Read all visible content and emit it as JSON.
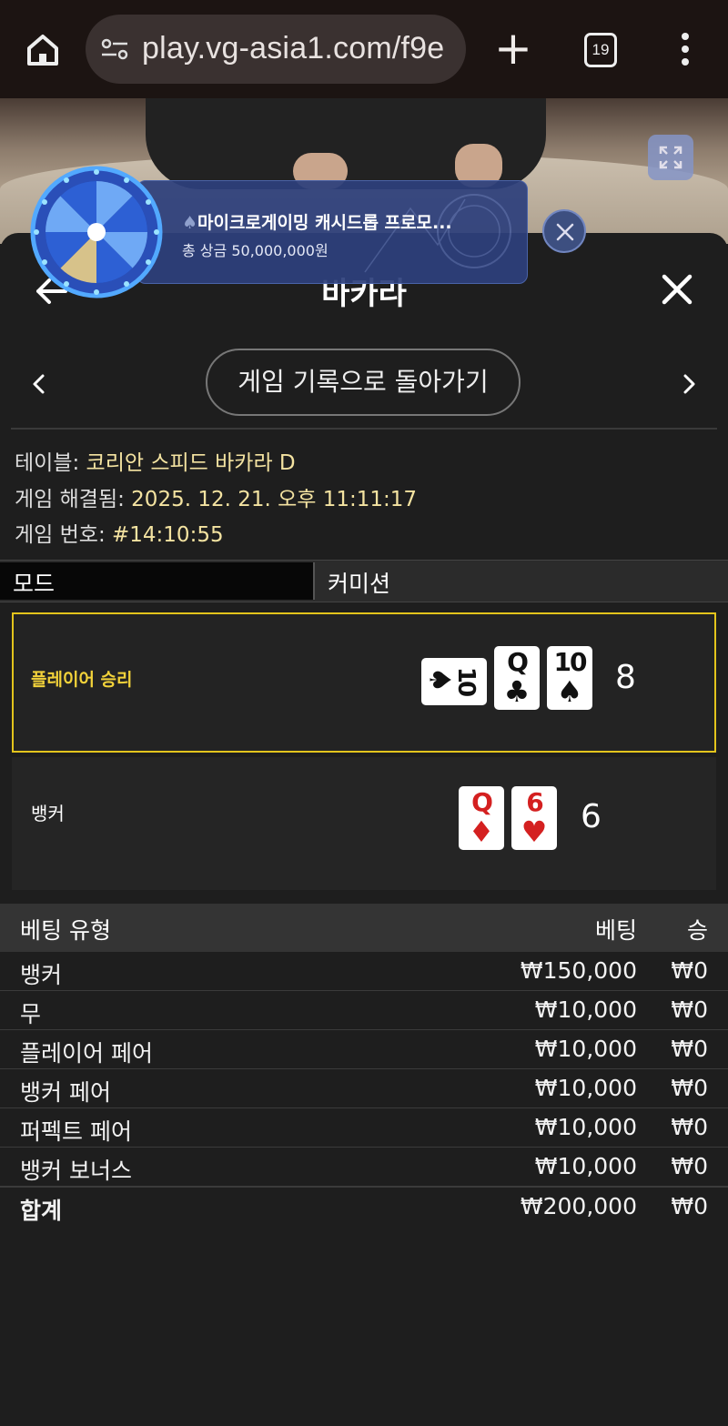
{
  "browser": {
    "url": "play.vg-asia1.com/f9e",
    "tab_count": "19"
  },
  "promo": {
    "title": "마이크로게이밍 캐시드롭 프로모...",
    "subtitle": "총 상금 50,000,000원"
  },
  "panel": {
    "title": "바카라",
    "history_button": "게임 기록으로 돌아가기"
  },
  "info": {
    "table_label": "테이블: ",
    "table_value": "코리안 스피드 바카라 D",
    "resolved_label": "게임 해결됨: ",
    "resolved_value": "2025. 12. 21. 오후 11:11:17",
    "game_no_label": "게임 번호: ",
    "game_no_value": "#14:10:55"
  },
  "mode": {
    "mode_label": "모드",
    "commission_label": "커미션"
  },
  "result": {
    "player_label": "플레이어 승리",
    "player_score": "8",
    "player_cards": [
      {
        "rank": "10",
        "suit": "♠",
        "color": "#111111",
        "orientation": "sideways"
      },
      {
        "rank": "Q",
        "suit": "♣",
        "color": "#111111"
      },
      {
        "rank": "10",
        "suit": "♠",
        "color": "#111111"
      }
    ],
    "banker_label": "뱅커",
    "banker_score": "6",
    "banker_cards": [
      {
        "rank": "Q",
        "suit": "♦",
        "color": "#d42020"
      },
      {
        "rank": "6",
        "suit": "♥",
        "color": "#d42020"
      }
    ]
  },
  "bets": {
    "header": {
      "type": "베팅 유형",
      "bet": "베팅",
      "win": "승"
    },
    "rows": [
      {
        "type": "뱅커",
        "bet": "₩150,000",
        "win": "₩0"
      },
      {
        "type": "무",
        "bet": "₩10,000",
        "win": "₩0"
      },
      {
        "type": "플레이어 페어",
        "bet": "₩10,000",
        "win": "₩0"
      },
      {
        "type": "뱅커 페어",
        "bet": "₩10,000",
        "win": "₩0"
      },
      {
        "type": "퍼펙트 페어",
        "bet": "₩10,000",
        "win": "₩0"
      },
      {
        "type": "뱅커 보너스",
        "bet": "₩10,000",
        "win": "₩0"
      }
    ],
    "total": {
      "type": "합계",
      "bet": "₩200,000",
      "win": "₩0"
    }
  },
  "colors": {
    "accent_gold": "#e3c41c",
    "info_value": "#f4e3a1",
    "panel_bg": "#1e1e1e",
    "promo_bg": "#2d407c"
  }
}
